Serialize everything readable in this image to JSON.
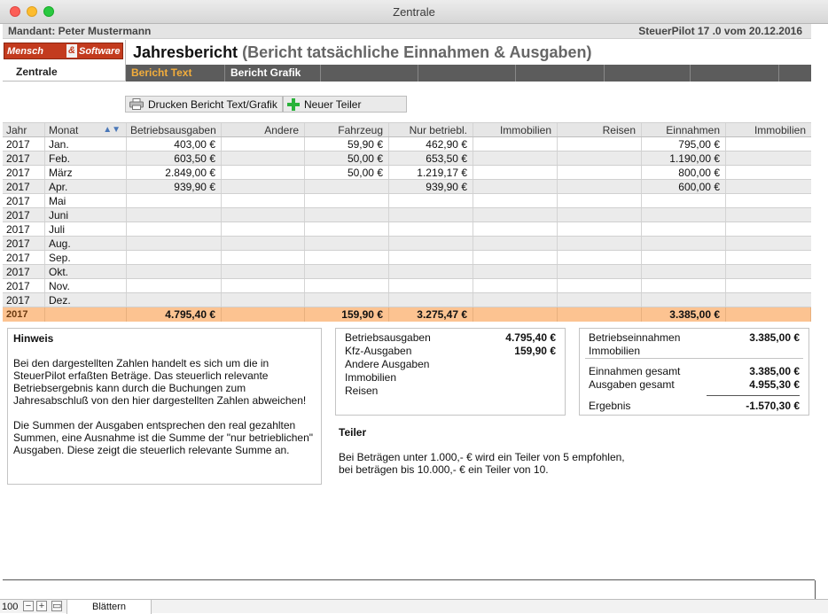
{
  "window": {
    "title": "Zentrale"
  },
  "header": {
    "mandant": "Mandant: Peter Mustermann",
    "version": "SteuerPilot 17 .0 vom 20.12.2016"
  },
  "logo": {
    "part1": "Mensch",
    "amp": "&",
    "part2": "Software"
  },
  "nav": {
    "zentrale_label": "Zentrale"
  },
  "report": {
    "title": "Jahresbericht",
    "subtitle": "(Bericht tatsächliche Einnahmen & Ausgaben)"
  },
  "subtabs": [
    {
      "label": "Bericht Text"
    },
    {
      "label": "Bericht Grafik"
    },
    {
      "label": ""
    },
    {
      "label": ""
    },
    {
      "label": ""
    },
    {
      "label": ""
    },
    {
      "label": ""
    },
    {
      "label": ""
    }
  ],
  "toolbar": {
    "print_label": "Drucken Bericht Text/Grafik",
    "add_label": "Neuer Teiler"
  },
  "table": {
    "headers": [
      "Jahr",
      "Monat",
      "Betriebsausgaben",
      "Andere",
      "Fahrzeug",
      "Nur betriebl.",
      "Immobilien",
      "Reisen",
      "Einnahmen",
      "Immobilien"
    ],
    "rows": [
      [
        "2017",
        "Jan.",
        "403,00 €",
        "",
        "59,90 €",
        "462,90 €",
        "",
        "",
        "795,00 €",
        ""
      ],
      [
        "2017",
        "Feb.",
        "603,50 €",
        "",
        "50,00 €",
        "653,50 €",
        "",
        "",
        "1.190,00 €",
        ""
      ],
      [
        "2017",
        "März",
        "2.849,00 €",
        "",
        "50,00 €",
        "1.219,17 €",
        "",
        "",
        "800,00 €",
        ""
      ],
      [
        "2017",
        "Apr.",
        "939,90 €",
        "",
        "",
        "939,90 €",
        "",
        "",
        "600,00 €",
        ""
      ],
      [
        "2017",
        "Mai",
        "",
        "",
        "",
        "",
        "",
        "",
        "",
        ""
      ],
      [
        "2017",
        "Juni",
        "",
        "",
        "",
        "",
        "",
        "",
        "",
        ""
      ],
      [
        "2017",
        "Juli",
        "",
        "",
        "",
        "",
        "",
        "",
        "",
        ""
      ],
      [
        "2017",
        "Aug.",
        "",
        "",
        "",
        "",
        "",
        "",
        "",
        ""
      ],
      [
        "2017",
        "Sep.",
        "",
        "",
        "",
        "",
        "",
        "",
        "",
        ""
      ],
      [
        "2017",
        "Okt.",
        "",
        "",
        "",
        "",
        "",
        "",
        "",
        ""
      ],
      [
        "2017",
        "Nov.",
        "",
        "",
        "",
        "",
        "",
        "",
        "",
        ""
      ],
      [
        "2017",
        "Dez.",
        "",
        "",
        "",
        "",
        "",
        "",
        "",
        ""
      ]
    ],
    "total": [
      "2017",
      "",
      "4.795,40 €",
      "",
      "159,90 €",
      "3.275,47 €",
      "",
      "",
      "3.385,00 €",
      ""
    ]
  },
  "hinweis": {
    "title": "Hinweis",
    "p1": "Bei den dargestellten Zahlen handelt es sich um die in SteuerPilot erfaßten Beträge. Das steuerlich relevante Betriebsergebnis kann durch die Buchungen zum Jahresabschluß von den hier dargestellten Zahlen abweichen!",
    "p2": "Die Summen der Ausgaben entsprechen den real gezahlten Summen, eine Ausnahme ist die Summe der \"nur betrieblichen\" Ausgaben. Diese zeigt die steuerlich relevante Summe an."
  },
  "summary_expenses": [
    {
      "label": "Betriebsausgaben",
      "value": "4.795,40 €"
    },
    {
      "label": "Kfz-Ausgaben",
      "value": "159,90 €"
    },
    {
      "label": "Andere Ausgaben",
      "value": ""
    },
    {
      "label": "Immobilien",
      "value": ""
    },
    {
      "label": "Reisen",
      "value": ""
    }
  ],
  "summary_income": {
    "betriebseinnahmen_label": "Betriebseinnahmen",
    "betriebseinnahmen_value": "3.385,00 €",
    "immobilien_label": "Immobilien",
    "einnahmen_gesamt_label": "Einnahmen gesamt",
    "einnahmen_gesamt_value": "3.385,00 €",
    "ausgaben_gesamt_label": "Ausgaben gesamt",
    "ausgaben_gesamt_value": "4.955,30 €",
    "ergebnis_label": "Ergebnis",
    "ergebnis_value": "-1.570,30 €"
  },
  "teiler": {
    "title": "Teiler",
    "line1": "Bei Beträgen unter 1.000,- € wird ein Teiler von 5 empfohlen,",
    "line2": "bei beträgen bis 10.000,- € ein Teiler von 10."
  },
  "statusbar": {
    "zoom": "100",
    "mode": "Blättern"
  },
  "colors": {
    "accent_tab": "#f2ad3c",
    "total_row": "#fcc391",
    "subtab_bar": "#5c5c5c",
    "logo_red": "#c33b1e"
  },
  "icons": {
    "sort": "sort-icon",
    "print": "printer-icon",
    "add": "plus-icon"
  }
}
